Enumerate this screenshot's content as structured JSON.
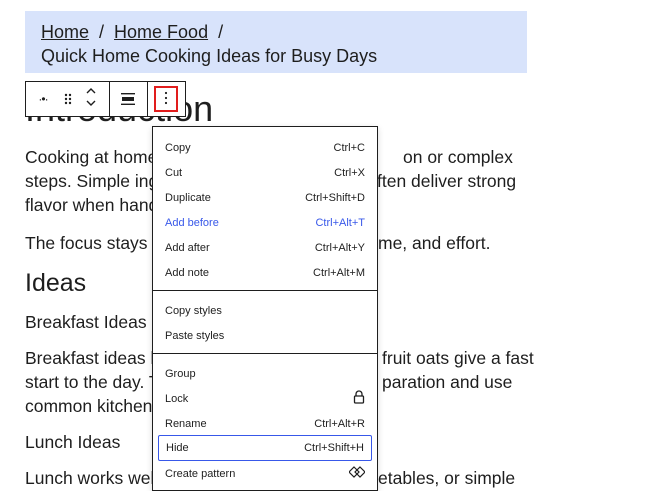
{
  "breadcrumb": {
    "home": "Home",
    "separator": "/",
    "category": "Home Food",
    "current": "Quick Home Cooking Ideas for Busy Days"
  },
  "article": {
    "heading_partial": "Introduction",
    "intro_line1_left": "Cooking at home",
    "intro_line1_right": "on or complex",
    "intro_line2_left": "steps. Simple ing",
    "intro_line2_right": "ften deliver strong",
    "intro_line3_left": "flavor when hand",
    "focus_left": "The focus stays o",
    "focus_right": "me, and effort.",
    "ideas_heading": "Ideas",
    "breakfast_heading": "Breakfast Ideas",
    "breakfast_line1_left": "Breakfast ideas li",
    "breakfast_line1_right": "fruit oats give a fast",
    "breakfast_line2_left": "start to the day. T",
    "breakfast_line2_right": "paration and use",
    "breakfast_line3_left": "common kitchen",
    "lunch_heading": "Lunch Ideas",
    "lunch_line1_left": "Lunch works well",
    "lunch_line1_right": "etables, or simple"
  },
  "toolbar": {
    "transform_icon": "paragraph-transform-icon",
    "drag_icon": "drag-handle-icon",
    "move_up_icon": "chevron-up-icon",
    "move_down_icon": "chevron-down-icon",
    "align_icon": "align-icon",
    "more_icon": "more-vertical-icon"
  },
  "menu": {
    "section1": [
      {
        "label": "Copy",
        "shortcut": "Ctrl+C"
      },
      {
        "label": "Cut",
        "shortcut": "Ctrl+X"
      },
      {
        "label": "Duplicate",
        "shortcut": "Ctrl+Shift+D"
      },
      {
        "label": "Add before",
        "shortcut": "Ctrl+Alt+T"
      },
      {
        "label": "Add after",
        "shortcut": "Ctrl+Alt+Y"
      },
      {
        "label": "Add note",
        "shortcut": "Ctrl+Alt+M"
      }
    ],
    "section2": [
      {
        "label": "Copy styles"
      },
      {
        "label": "Paste styles"
      }
    ],
    "section3": [
      {
        "label": "Group"
      },
      {
        "label": "Lock",
        "icon": "lock-icon"
      },
      {
        "label": "Rename",
        "shortcut": "Ctrl+Alt+R"
      },
      {
        "label": "Hide",
        "shortcut": "Ctrl+Shift+H"
      },
      {
        "label": "Create pattern",
        "icon": "pattern-icon"
      }
    ]
  },
  "colors": {
    "accent": "#3858e9",
    "banner": "#d8e3fb",
    "highlight_border": "#e11d1d"
  }
}
